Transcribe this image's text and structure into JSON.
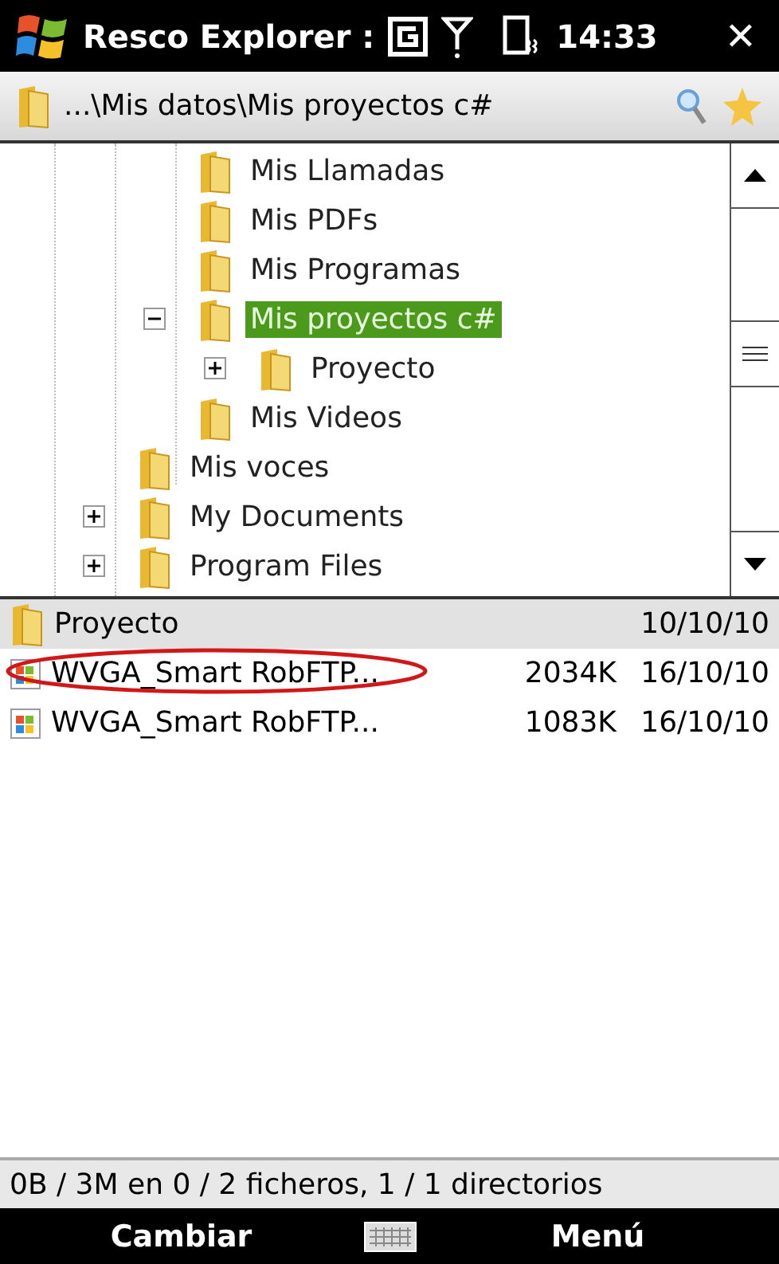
{
  "title_bar": {
    "title": "Resco Explorer :",
    "time": "14:33",
    "close": "✕"
  },
  "path_bar": {
    "path": "...\\Mis datos\\Mis proyectos c#"
  },
  "tree": {
    "items": [
      {
        "children": [
          {
            "label": "Mis Llamadas",
            "selected": false
          },
          {
            "label": "Mis PDFs",
            "selected": false
          },
          {
            "label": "Mis Programas",
            "selected": false
          },
          {
            "label": "Mis proyectos c#",
            "selected": true,
            "expanded": true,
            "children": [
              {
                "label": "Proyecto",
                "selected": false,
                "expanded": false
              }
            ]
          },
          {
            "label": "Mis Videos",
            "selected": false
          }
        ]
      },
      {
        "label": "Mis voces",
        "selected": false
      },
      {
        "label": "My Documents",
        "selected": false,
        "expanded": false
      },
      {
        "label": "Program Files",
        "selected": false,
        "expanded": false
      }
    ]
  },
  "files": [
    {
      "kind": "folder",
      "name": "Proyecto",
      "date": "10/10/10",
      "selected": true,
      "circled": false
    },
    {
      "kind": "app",
      "name": "WVGA_Smart RobFTP...",
      "size": "2034K",
      "date": "16/10/10",
      "selected": false,
      "circled": true
    },
    {
      "kind": "app",
      "name": "WVGA_Smart RobFTP...",
      "size": "1083K",
      "date": "16/10/10",
      "selected": false,
      "circled": false
    }
  ],
  "status_bar": "0B / 3M en 0 / 2 ficheros, 1 / 1 directorios",
  "soft_keys": {
    "left": "Cambiar",
    "right": "Menú"
  }
}
